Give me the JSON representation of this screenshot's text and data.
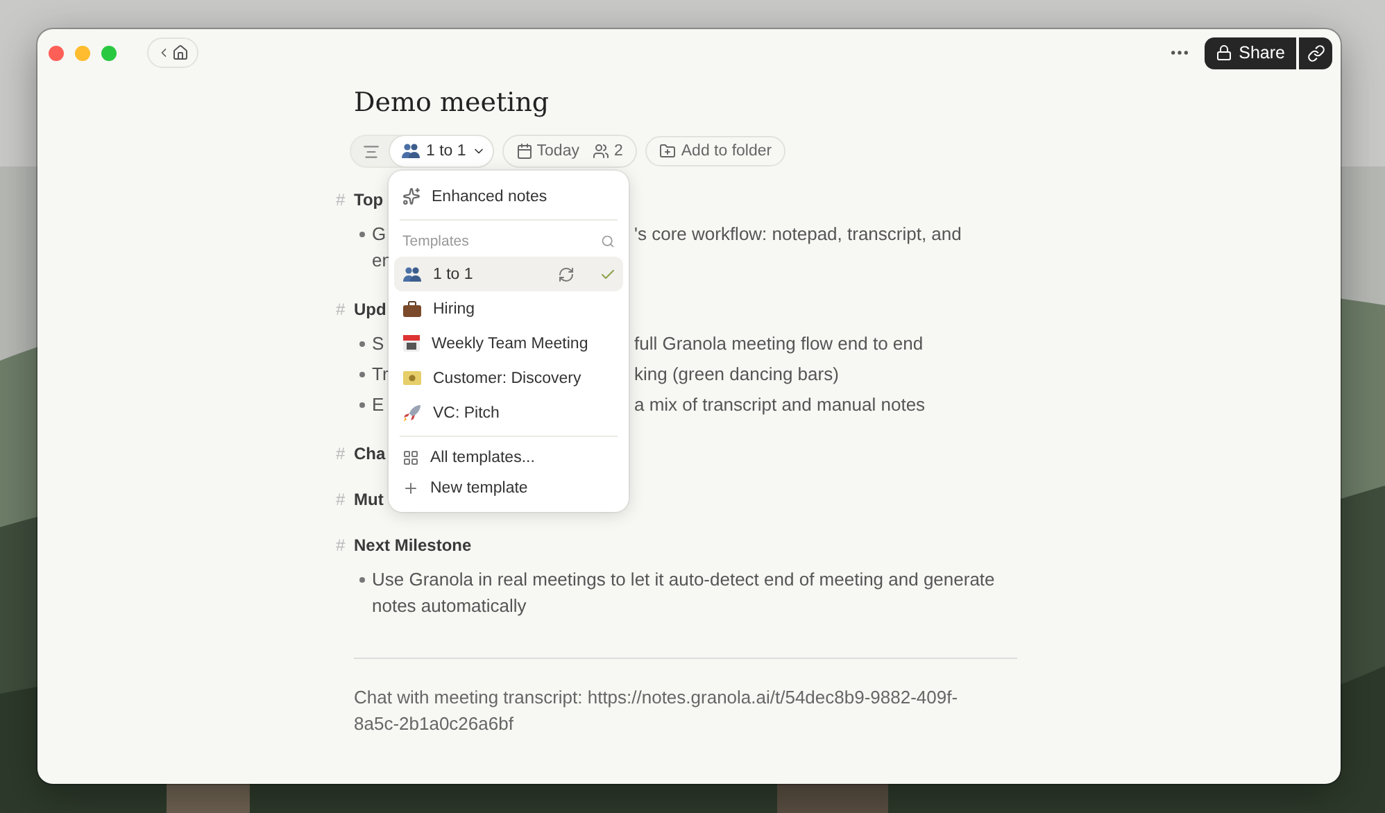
{
  "title": "Demo meeting",
  "toolbar": {
    "template_chip": {
      "label": "1 to 1",
      "expanded": true
    },
    "date": "Today",
    "attendees": "2",
    "folder": "Add to folder"
  },
  "share": "Share",
  "note": [
    {
      "heading": {
        "marker": "#",
        "left": "Top"
      },
      "bullets": [
        {
          "lines": [
            {
              "left": "G",
              "right": "'s core workflow: notepad, transcript, and"
            },
            {
              "left": "en"
            }
          ]
        }
      ]
    },
    {
      "heading": {
        "marker": "#",
        "left": "Upd"
      },
      "bullets": [
        {
          "lines": [
            {
              "left": "S",
              "right": "full Granola meeting flow end to end"
            }
          ]
        },
        {
          "lines": [
            {
              "left": "Tr",
              "right": "king (green dancing bars)"
            }
          ]
        },
        {
          "lines": [
            {
              "left": "E",
              "right": "a mix of transcript and manual notes"
            }
          ]
        }
      ]
    },
    {
      "heading": {
        "marker": "#",
        "left": "Cha"
      }
    },
    {
      "heading": {
        "marker": "#",
        "left": "Mut"
      }
    },
    {
      "heading": {
        "marker": "#",
        "text": "Next Milestone"
      },
      "bullets": [
        {
          "text": "Use Granola in real meetings to let it auto-detect end of meeting and generate notes automatically"
        }
      ]
    }
  ],
  "dropdown": {
    "enhanced": "Enhanced notes",
    "section": "Templates",
    "templates": [
      {
        "label": "1 to 1",
        "selected": true
      },
      {
        "label": "Hiring",
        "selected": false
      },
      {
        "label": "Weekly Team Meeting",
        "selected": false
      },
      {
        "label": "Customer: Discovery",
        "selected": false
      },
      {
        "label": "VC: Pitch",
        "selected": false
      }
    ],
    "actions": [
      "All templates...",
      "New template"
    ]
  },
  "footer": "Chat with meeting transcript: https://notes.granola.ai/t/54dec8b9-9882-409f-8a5c-2b1a0c26a6bf"
}
